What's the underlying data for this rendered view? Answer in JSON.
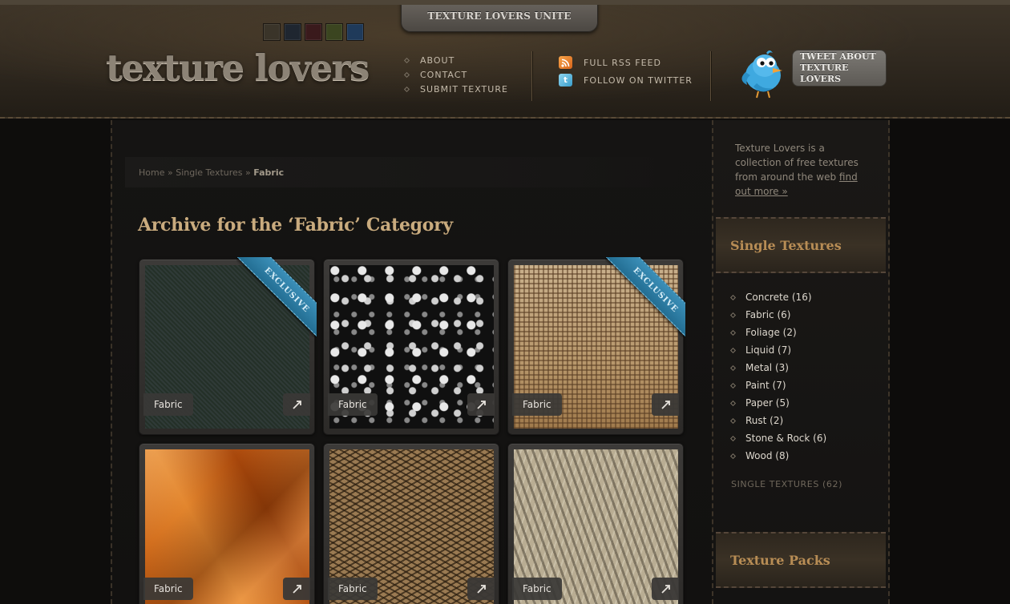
{
  "header": {
    "tagline": "TEXTURE LOVERS UNITE",
    "logo": "texture lovers",
    "swatches": [
      "#3a3429",
      "#1f2630",
      "#3a1a1c",
      "#3b4520",
      "#1f3a5a"
    ],
    "nav": [
      "ABOUT",
      "CONTACT",
      "SUBMIT TEXTURE"
    ],
    "links": {
      "rss": "FULL RSS FEED",
      "twitter": "FOLLOW ON TWITTER"
    },
    "tweet": {
      "line1": "TWEET ABOUT",
      "line2": "TEXTURE LOVERS"
    }
  },
  "breadcrumb": {
    "home": "Home",
    "sep": "»",
    "section": "Single Textures",
    "current": "Fabric"
  },
  "page_title": "Archive for the ‘Fabric’ Category",
  "grid": {
    "ribbon_label": "EXCLUSIVE",
    "expand_icon": "expand-icon",
    "items": [
      {
        "label": "Fabric",
        "exclusive": true
      },
      {
        "label": "Fabric",
        "exclusive": false
      },
      {
        "label": "Fabric",
        "exclusive": true
      },
      {
        "label": "Fabric",
        "exclusive": false
      },
      {
        "label": "Fabric",
        "exclusive": false
      },
      {
        "label": "Fabric",
        "exclusive": false
      }
    ]
  },
  "sidebar": {
    "about_text": "Texture Lovers is a collection of free textures from around the web",
    "about_link": "find out more »",
    "single_heading": "Single Textures",
    "categories": [
      "Concrete (16)",
      "Fabric (6)",
      "Foliage (2)",
      "Liquid (7)",
      "Metal (3)",
      "Paint (7)",
      "Paper (5)",
      "Rust (2)",
      "Stone & Rock (6)",
      "Wood (8)"
    ],
    "total": "SINGLE TEXTURES (62)",
    "packs_heading": "Texture Packs"
  }
}
